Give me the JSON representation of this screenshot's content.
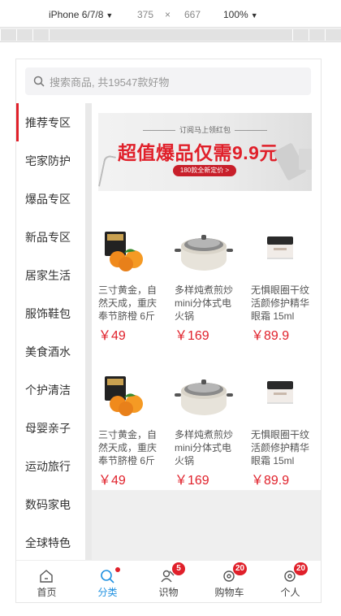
{
  "devtools": {
    "device": "iPhone 6/7/8",
    "caret": "▼",
    "width": "375",
    "times": "×",
    "height": "667",
    "zoom": "100%"
  },
  "search": {
    "placeholder": "搜索商品, 共19547款好物"
  },
  "sidebar": {
    "items": [
      {
        "label": "推荐专区",
        "active": true
      },
      {
        "label": "宅家防护"
      },
      {
        "label": "爆品专区"
      },
      {
        "label": "新品专区"
      },
      {
        "label": "居家生活"
      },
      {
        "label": "服饰鞋包"
      },
      {
        "label": "美食酒水"
      },
      {
        "label": "个护清洁"
      },
      {
        "label": "母婴亲子"
      },
      {
        "label": "运动旅行"
      },
      {
        "label": "数码家电"
      },
      {
        "label": "全球特色"
      }
    ]
  },
  "banner": {
    "subtitle": "订阅马上领红包",
    "headline": "超值爆品仅需9.9元",
    "pill": "180款全新定价 >"
  },
  "products": [
    [
      {
        "name": "三寸黄金，自然天成，重庆奉节脐橙 6斤",
        "price": "￥49",
        "image": "orange"
      },
      {
        "name": "多样炖煮煎炒mini分体式电火锅",
        "price": "￥169",
        "image": "hotpot"
      },
      {
        "name": "无惧眼圈干纹活颜修护精华眼霜 15ml",
        "price": "￥89.9",
        "image": "cream"
      }
    ],
    [
      {
        "name": "三寸黄金，自然天成，重庆奉节脐橙 6斤",
        "price": "￥49",
        "image": "orange"
      },
      {
        "name": "多样炖煮煎炒mini分体式电火锅",
        "price": "￥169",
        "image": "hotpot"
      },
      {
        "name": "无惧眼圈干纹活颜修护精华眼霜 15ml",
        "price": "￥89.9",
        "image": "cream"
      }
    ]
  ],
  "tabbar": {
    "items": [
      {
        "label": "首页",
        "icon": "home-icon"
      },
      {
        "label": "分类",
        "icon": "search-icon",
        "active": true,
        "dot": true
      },
      {
        "label": "识物",
        "icon": "discover-icon",
        "badge": "5"
      },
      {
        "label": "购物车",
        "icon": "cart-icon",
        "badge": "20"
      },
      {
        "label": "个人",
        "icon": "user-icon",
        "badge": "20"
      }
    ]
  },
  "colors": {
    "accent": "#e0202a",
    "active_tab": "#1e90e0",
    "content_bg": "#efefef"
  }
}
